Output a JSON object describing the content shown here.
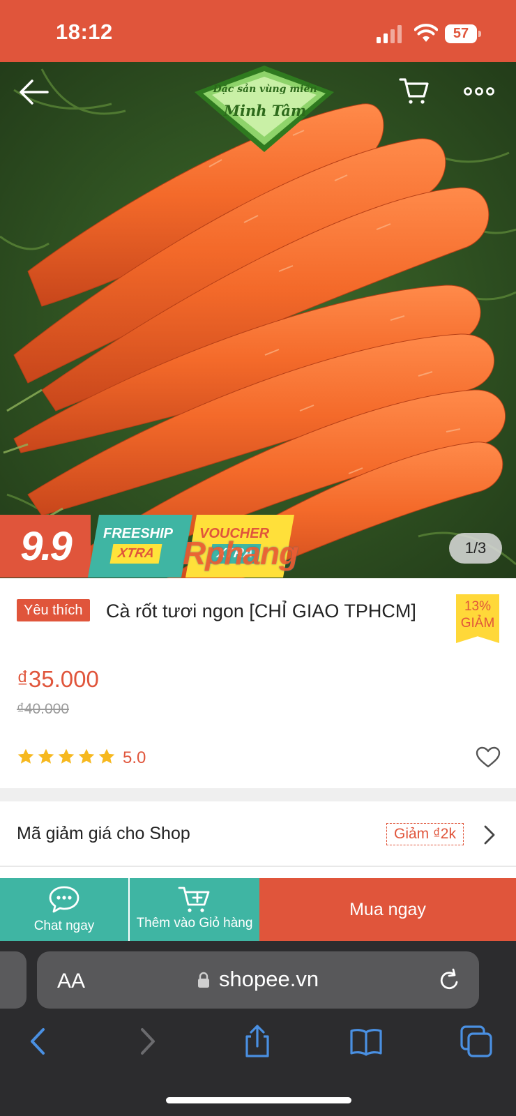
{
  "status_bar": {
    "time": "18:12",
    "battery": "57"
  },
  "hero": {
    "logo_line1": "Đặc sản vùng miền",
    "logo_line2": "Minh Tâm",
    "page_indicator": "1/3"
  },
  "promo_banner": {
    "sale_label": "9.9",
    "freeship_label": "FREESHIP",
    "freeship_sub": "XTRA",
    "voucher_label": "VOUCHER",
    "voucher_sub": "XTRA",
    "watermark": "Rphang"
  },
  "product": {
    "favorite_tag": "Yêu thích",
    "title": "Cà rốt tươi ngon [CHỈ GIAO TPHCM]",
    "discount_percent": "13%",
    "discount_label": "GIẢM",
    "price": "₫35.000",
    "original_price": "₫40.000",
    "rating": "5.0",
    "stars": 5
  },
  "shop_voucher": {
    "label": "Mã giảm giá cho Shop",
    "chip": "Giảm ₫2k"
  },
  "action_bar": {
    "chat_label": "Chat ngay",
    "add_to_cart_label": "Thêm vào Giỏ hàng",
    "buy_now_label": "Mua ngay"
  },
  "browser": {
    "text_size_label": "AA",
    "url": "shopee.vn"
  },
  "colors": {
    "brand_orange": "#e0553b",
    "teal": "#3fb5a3",
    "yellow": "#ffd839",
    "star": "#f6b81e"
  }
}
